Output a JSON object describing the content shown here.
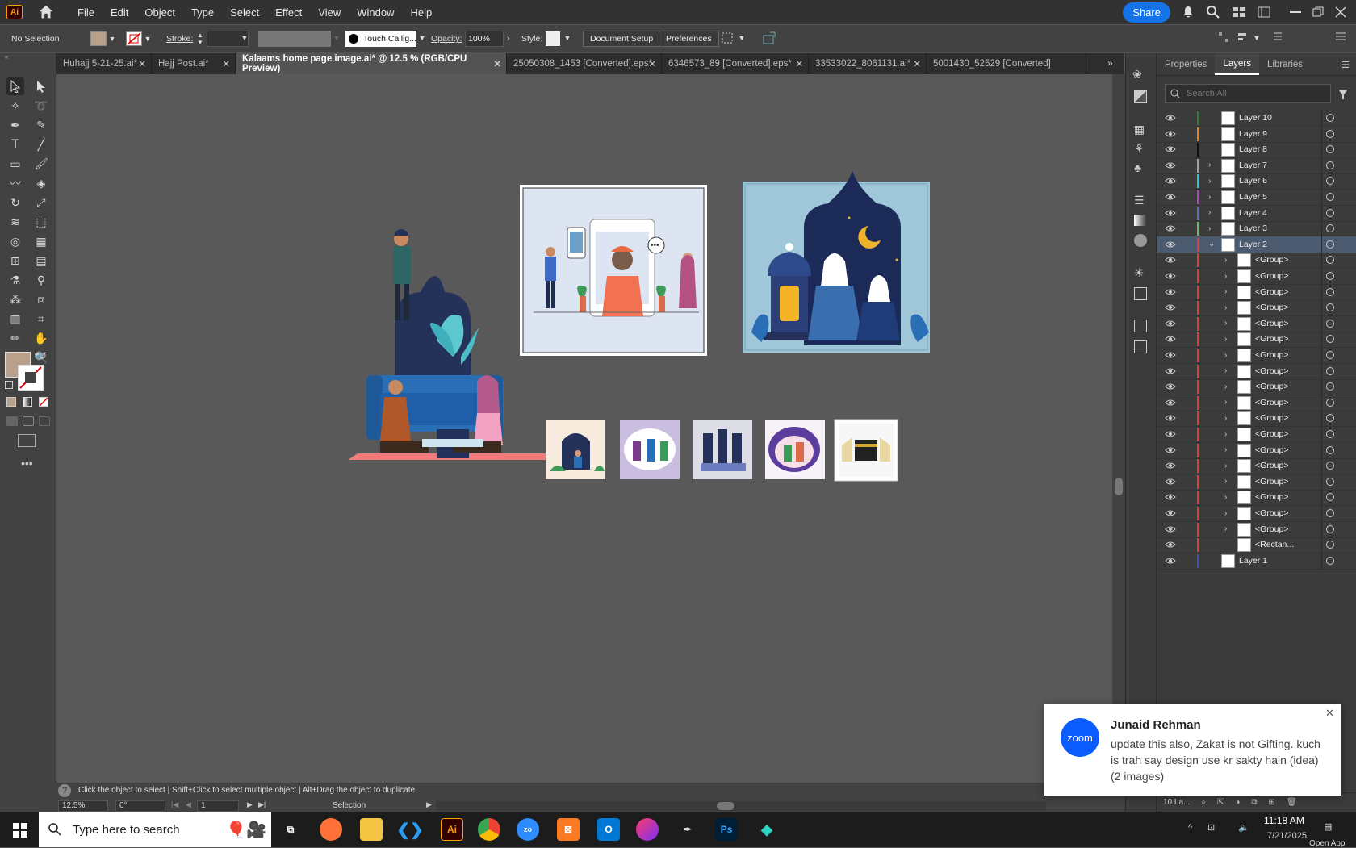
{
  "app": {
    "logo": "Ai",
    "menus": [
      "File",
      "Edit",
      "Object",
      "Type",
      "Select",
      "Effect",
      "View",
      "Window",
      "Help"
    ],
    "share_label": "Share"
  },
  "control_bar": {
    "selection_status": "No Selection",
    "fill_color": "#b9a08a",
    "stroke_label": "Stroke:",
    "brush_name": "Touch Callig...",
    "opacity_label": "Opacity:",
    "opacity_value": "100%",
    "style_label": "Style:",
    "document_setup_label": "Document Setup",
    "preferences_label": "Preferences"
  },
  "tabs": [
    {
      "label": "Huhajj 5-21-25.ai*",
      "active": false
    },
    {
      "label": "Hajj Post.ai*",
      "active": false
    },
    {
      "label": "Kalaams home page image.ai* @ 12.5 % (RGB/CPU Preview)",
      "active": true
    },
    {
      "label": "25050308_1453 [Converted].eps*",
      "active": false
    },
    {
      "label": "6346573_89 [Converted].eps*",
      "active": false
    },
    {
      "label": "33533022_8061131.ai*",
      "active": false
    },
    {
      "label": "5001430_52529 [Converted]",
      "active": false
    }
  ],
  "panel": {
    "tabs": [
      "Properties",
      "Layers",
      "Libraries"
    ],
    "active_tab": "Layers",
    "search_placeholder": "Search All",
    "layers": [
      {
        "name": "Layer 10",
        "color": "#2e7d32",
        "expandable": false,
        "indent": 0
      },
      {
        "name": "Layer 9",
        "color": "#e67e22",
        "expandable": false,
        "indent": 0
      },
      {
        "name": "Layer 8",
        "color": "#111111",
        "expandable": false,
        "indent": 0
      },
      {
        "name": "Layer 7",
        "color": "#9e9e9e",
        "expandable": true,
        "indent": 0
      },
      {
        "name": "Layer 6",
        "color": "#26c6da",
        "expandable": true,
        "indent": 0
      },
      {
        "name": "Layer 5",
        "color": "#ab47bc",
        "expandable": true,
        "indent": 0
      },
      {
        "name": "Layer 4",
        "color": "#5c6bc0",
        "expandable": true,
        "indent": 0
      },
      {
        "name": "Layer 3",
        "color": "#66bb6a",
        "expandable": true,
        "indent": 0
      },
      {
        "name": "Layer 2",
        "color": "#e53935",
        "expandable": true,
        "expanded": true,
        "indent": 0,
        "selected": true
      },
      {
        "name": "<Group>",
        "color": "#e53935",
        "expandable": true,
        "indent": 1
      },
      {
        "name": "<Group>",
        "color": "#e53935",
        "expandable": true,
        "indent": 1
      },
      {
        "name": "<Group>",
        "color": "#e53935",
        "expandable": true,
        "indent": 1
      },
      {
        "name": "<Group>",
        "color": "#e53935",
        "expandable": true,
        "indent": 1
      },
      {
        "name": "<Group>",
        "color": "#e53935",
        "expandable": true,
        "indent": 1
      },
      {
        "name": "<Group>",
        "color": "#e53935",
        "expandable": true,
        "indent": 1
      },
      {
        "name": "<Group>",
        "color": "#e53935",
        "expandable": true,
        "indent": 1
      },
      {
        "name": "<Group>",
        "color": "#e53935",
        "expandable": true,
        "indent": 1
      },
      {
        "name": "<Group>",
        "color": "#e53935",
        "expandable": true,
        "indent": 1
      },
      {
        "name": "<Group>",
        "color": "#e53935",
        "expandable": true,
        "indent": 1
      },
      {
        "name": "<Group>",
        "color": "#e53935",
        "expandable": true,
        "indent": 1
      },
      {
        "name": "<Group>",
        "color": "#e53935",
        "expandable": true,
        "indent": 1
      },
      {
        "name": "<Group>",
        "color": "#e53935",
        "expandable": true,
        "indent": 1
      },
      {
        "name": "<Group>",
        "color": "#e53935",
        "expandable": true,
        "indent": 1
      },
      {
        "name": "<Group>",
        "color": "#e53935",
        "expandable": true,
        "indent": 1
      },
      {
        "name": "<Group>",
        "color": "#e53935",
        "expandable": true,
        "indent": 1
      },
      {
        "name": "<Group>",
        "color": "#e53935",
        "expandable": true,
        "indent": 1
      },
      {
        "name": "<Group>",
        "color": "#e53935",
        "expandable": true,
        "indent": 1
      },
      {
        "name": "<Rectan...",
        "color": "#e53935",
        "expandable": false,
        "indent": 1
      },
      {
        "name": "Layer 1",
        "color": "#3f51b5",
        "expandable": false,
        "indent": 0
      }
    ],
    "layers_count": "10 La..."
  },
  "status": {
    "hint": "Click the object to select  |  Shift+Click to select multiple object  |  Alt+Drag the object to duplicate",
    "zoom": "12.5%",
    "rotation": "0°",
    "artboard": "1",
    "tool": "Selection"
  },
  "toast": {
    "app": "zoom",
    "sender": "Junaid Rehman",
    "message": "update this also, Zakat is not Gifting. kuch is trah say design use kr sakty hain (idea) (2 images)"
  },
  "taskbar": {
    "search_placeholder": "Type here to search",
    "time": "11:18 AM",
    "date": "7/21/2025",
    "open_app": "Open App"
  }
}
